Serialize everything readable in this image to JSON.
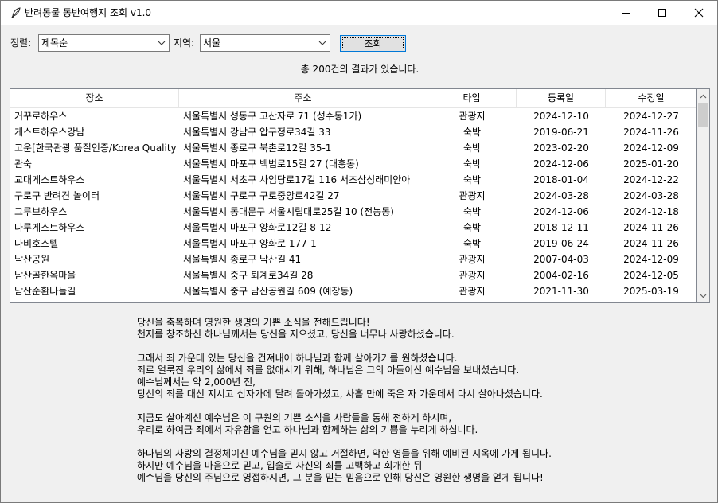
{
  "window": {
    "title": "반려동물 동반여행지 조회 v1.0"
  },
  "toolbar": {
    "sort_label": "정렬:",
    "sort_value": "제목순",
    "region_label": "지역:",
    "region_value": "서울",
    "search_label": "조회"
  },
  "result_text": "총 200건의 결과가 있습니다.",
  "table": {
    "headers": [
      "장소",
      "주소",
      "타입",
      "등록일",
      "수정일"
    ],
    "rows": [
      [
        "거꾸로하우스",
        "서울특별시 성동구 고산자로 71 (성수동1가)",
        "관광지",
        "2024-12-10",
        "2024-12-27"
      ],
      [
        "게스트하우스강남",
        "서울특별시 강남구 압구정로34길 33",
        "숙박",
        "2019-06-21",
        "2024-11-26"
      ],
      [
        "고운[한국관광 품질인증/Korea Quality",
        "서울특별시 종로구 북촌로12길 35-1",
        "숙박",
        "2023-02-20",
        "2024-12-09"
      ],
      [
        "관숙",
        "서울특별시 마포구 백범로15길 27 (대흥동)",
        "숙박",
        "2024-12-06",
        "2025-01-20"
      ],
      [
        "교대게스트하우스",
        "서울특별시 서초구 사임당로17길 116 서초삼성래미안아",
        "숙박",
        "2018-01-04",
        "2024-12-22"
      ],
      [
        "구로구 반려견 놀이터",
        "서울특별시 구로구 구로중앙로42길 27",
        "관광지",
        "2024-03-28",
        "2024-03-28"
      ],
      [
        "그루브하우스",
        "서울특별시 동대문구 서울시립대로25길 10 (전농동)",
        "숙박",
        "2024-12-06",
        "2024-12-18"
      ],
      [
        "나루게스트하우스",
        "서울특별시 마포구 양화로12길 8-12",
        "숙박",
        "2018-12-11",
        "2024-11-26"
      ],
      [
        "나비호스텔",
        "서울특별시 마포구 양화로 177-1",
        "숙박",
        "2019-06-24",
        "2024-11-26"
      ],
      [
        "낙산공원",
        "서울특별시 종로구 낙산길 41",
        "관광지",
        "2007-04-03",
        "2024-12-09"
      ],
      [
        "남산골한옥마을",
        "서울특별시 중구 퇴계로34길 28",
        "관광지",
        "2004-02-16",
        "2024-12-05"
      ],
      [
        "남산순환나들길",
        "서울특별시 중구 남산공원길 609 (예장동)",
        "관광지",
        "2021-11-30",
        "2025-03-19"
      ]
    ]
  },
  "message": {
    "p1_l1": "당신을 축복하며 영원한 생명의 기쁜 소식을 전해드립니다!",
    "p1_l2": "천지를 창조하신 하나님께서는 당신을 지으셨고, 당신을 너무나 사랑하셨습니다.",
    "p2_l1": "그래서 죄 가운데 있는 당신을 건져내어 하나님과 함께 살아가기를 원하셨습니다.",
    "p2_l2": "죄로 얼룩진 우리의 삶에서 죄를 없애시기 위해, 하나님은 그의 아들이신 예수님을 보내셨습니다.",
    "p2_l3": "예수님께서는 약 2,000년 전,",
    "p2_l4": "당신의 죄를 대신 지시고 십자가에 달려 돌아가셨고, 사흘 만에 죽은 자 가운데서 다시 살아나셨습니다.",
    "p3_l1": "지금도 살아계신 예수님은 이 구원의 기쁜 소식을 사람들을 통해 전하게 하시며,",
    "p3_l2": "우리로 하여금 죄에서 자유함을 얻고 하나님과 함께하는 삶의 기쁨을 누리게 하십니다.",
    "p4_l1": "하나님의 사랑의 결정체이신 예수님을 믿지 않고 거절하면, 악한 영들을 위해 예비된 지옥에 가게 됩니다.",
    "p4_l2": "하지만 예수님을 마음으로 믿고, 입술로 자신의 죄를 고백하고 회개한 뒤",
    "p4_l3": "예수님을 당신의 주님으로 영접하시면, 그 분을 믿는 믿음으로 인해 당신은 영원한 생명을 얻게 됩니다!"
  },
  "icons": {
    "app": "feather-icon",
    "minimize": "minimize-icon",
    "maximize": "maximize-icon",
    "close": "close-icon",
    "dropdown": "chevron-down-icon",
    "scroll_up": "scroll-up-icon",
    "scroll_down": "scroll-down-icon"
  }
}
